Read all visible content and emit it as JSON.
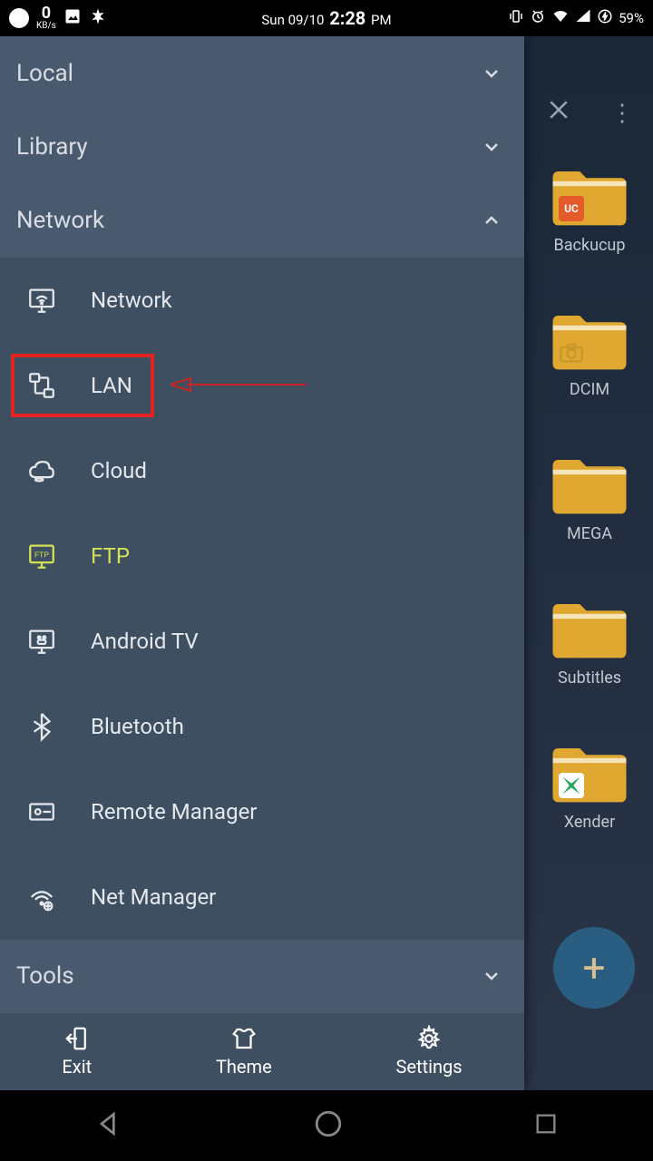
{
  "status": {
    "kbs_value": "0",
    "kbs_unit": "KB/s",
    "date": "Sun 09/10",
    "time": "2:28",
    "ampm": "PM",
    "battery": "59%"
  },
  "toolbar": {
    "close": "✕",
    "more": "⋮"
  },
  "folders": [
    {
      "label": "Backucup",
      "overlay": "uc"
    },
    {
      "label": "DCIM",
      "overlay": "camera"
    },
    {
      "label": "MEGA",
      "overlay": ""
    },
    {
      "label": "Subtitles",
      "overlay": ""
    },
    {
      "label": "Xender",
      "overlay": "x"
    }
  ],
  "drawer": {
    "sections": {
      "local": "Local",
      "library": "Library",
      "network": "Network",
      "tools": "Tools"
    },
    "network_items": [
      {
        "label": "Network",
        "icon": "wifi-monitor"
      },
      {
        "label": "LAN",
        "icon": "lan"
      },
      {
        "label": "Cloud",
        "icon": "cloud"
      },
      {
        "label": "FTP",
        "icon": "ftp",
        "highlight": true
      },
      {
        "label": "Android TV",
        "icon": "tv"
      },
      {
        "label": "Bluetooth",
        "icon": "bluetooth"
      },
      {
        "label": "Remote Manager",
        "icon": "remote"
      },
      {
        "label": "Net Manager",
        "icon": "netmgr"
      }
    ],
    "footer": {
      "exit": "Exit",
      "theme": "Theme",
      "settings": "Settings"
    }
  },
  "fab": {
    "label": "+"
  }
}
